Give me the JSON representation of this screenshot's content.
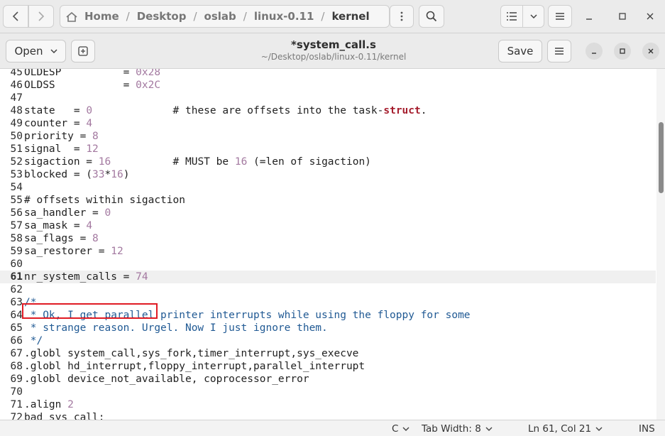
{
  "file_manager": {
    "breadcrumbs": [
      "Home",
      "Desktop",
      "oslab",
      "linux-0.11",
      "kernel"
    ]
  },
  "editor": {
    "open_label": "Open",
    "title": "*system_call.s",
    "subtitle": "~/Desktop/oslab/linux-0.11/kernel",
    "save_label": "Save",
    "lines": [
      {
        "n": "45",
        "parts": [
          {
            "t": "OLDESP          = "
          },
          {
            "t": "0x28",
            "c": "num"
          }
        ]
      },
      {
        "n": "46",
        "parts": [
          {
            "t": "OLDSS           = "
          },
          {
            "t": "0x2C",
            "c": "num"
          }
        ]
      },
      {
        "n": "47",
        "parts": []
      },
      {
        "n": "48",
        "parts": [
          {
            "t": "state   = "
          },
          {
            "t": "0",
            "c": "num"
          },
          {
            "t": "             # these are offsets into the task-"
          },
          {
            "t": "struct",
            "c": "kw"
          },
          {
            "t": "."
          }
        ]
      },
      {
        "n": "49",
        "parts": [
          {
            "t": "counter = "
          },
          {
            "t": "4",
            "c": "num"
          }
        ]
      },
      {
        "n": "50",
        "parts": [
          {
            "t": "priority = "
          },
          {
            "t": "8",
            "c": "num"
          }
        ]
      },
      {
        "n": "51",
        "parts": [
          {
            "t": "signal  = "
          },
          {
            "t": "12",
            "c": "num"
          }
        ]
      },
      {
        "n": "52",
        "parts": [
          {
            "t": "sigaction = "
          },
          {
            "t": "16",
            "c": "num"
          },
          {
            "t": "          # MUST be "
          },
          {
            "t": "16",
            "c": "num"
          },
          {
            "t": " (=len of sigaction)"
          }
        ]
      },
      {
        "n": "53",
        "parts": [
          {
            "t": "blocked = ("
          },
          {
            "t": "33",
            "c": "num"
          },
          {
            "t": "*"
          },
          {
            "t": "16",
            "c": "num"
          },
          {
            "t": ")"
          }
        ]
      },
      {
        "n": "54",
        "parts": []
      },
      {
        "n": "55",
        "parts": [
          {
            "t": "# offsets within sigaction"
          }
        ]
      },
      {
        "n": "56",
        "parts": [
          {
            "t": "sa_handler = "
          },
          {
            "t": "0",
            "c": "num"
          }
        ]
      },
      {
        "n": "57",
        "parts": [
          {
            "t": "sa_mask = "
          },
          {
            "t": "4",
            "c": "num"
          }
        ]
      },
      {
        "n": "58",
        "parts": [
          {
            "t": "sa_flags = "
          },
          {
            "t": "8",
            "c": "num"
          }
        ]
      },
      {
        "n": "59",
        "parts": [
          {
            "t": "sa_restorer = "
          },
          {
            "t": "12",
            "c": "num"
          }
        ]
      },
      {
        "n": "60",
        "parts": []
      },
      {
        "n": "61",
        "current": true,
        "parts": [
          {
            "t": "nr_system_calls = "
          },
          {
            "t": "74",
            "c": "num"
          }
        ]
      },
      {
        "n": "62",
        "parts": []
      },
      {
        "n": "63",
        "parts": [
          {
            "t": "/*",
            "c": "com"
          }
        ]
      },
      {
        "n": "64",
        "parts": [
          {
            "t": " * Ok, I get parallel printer interrupts while using the floppy for some",
            "c": "com"
          }
        ]
      },
      {
        "n": "65",
        "parts": [
          {
            "t": " * strange reason. Urgel. Now I just ignore them.",
            "c": "com"
          }
        ]
      },
      {
        "n": "66",
        "parts": [
          {
            "t": " */",
            "c": "com"
          }
        ]
      },
      {
        "n": "67",
        "parts": [
          {
            "t": ".globl system_call,sys_fork,timer_interrupt,sys_execve"
          }
        ]
      },
      {
        "n": "68",
        "parts": [
          {
            "t": ".globl hd_interrupt,floppy_interrupt,parallel_interrupt"
          }
        ]
      },
      {
        "n": "69",
        "parts": [
          {
            "t": ".globl device_not_available, coprocessor_error"
          }
        ]
      },
      {
        "n": "70",
        "parts": []
      },
      {
        "n": "71",
        "parts": [
          {
            "t": ".align "
          },
          {
            "t": "2",
            "c": "num"
          }
        ]
      },
      {
        "n": "72",
        "parts": [
          {
            "t": "bad_sys_call:"
          }
        ]
      }
    ]
  },
  "statusbar": {
    "language": "C",
    "tab_width": "Tab Width: 8",
    "position": "Ln 61, Col 21",
    "mode": "INS"
  },
  "colors": {
    "number": "#a379a0",
    "keyword": "#a51d2d",
    "comment": "#215a94",
    "highlight_box": "#e01b24"
  }
}
